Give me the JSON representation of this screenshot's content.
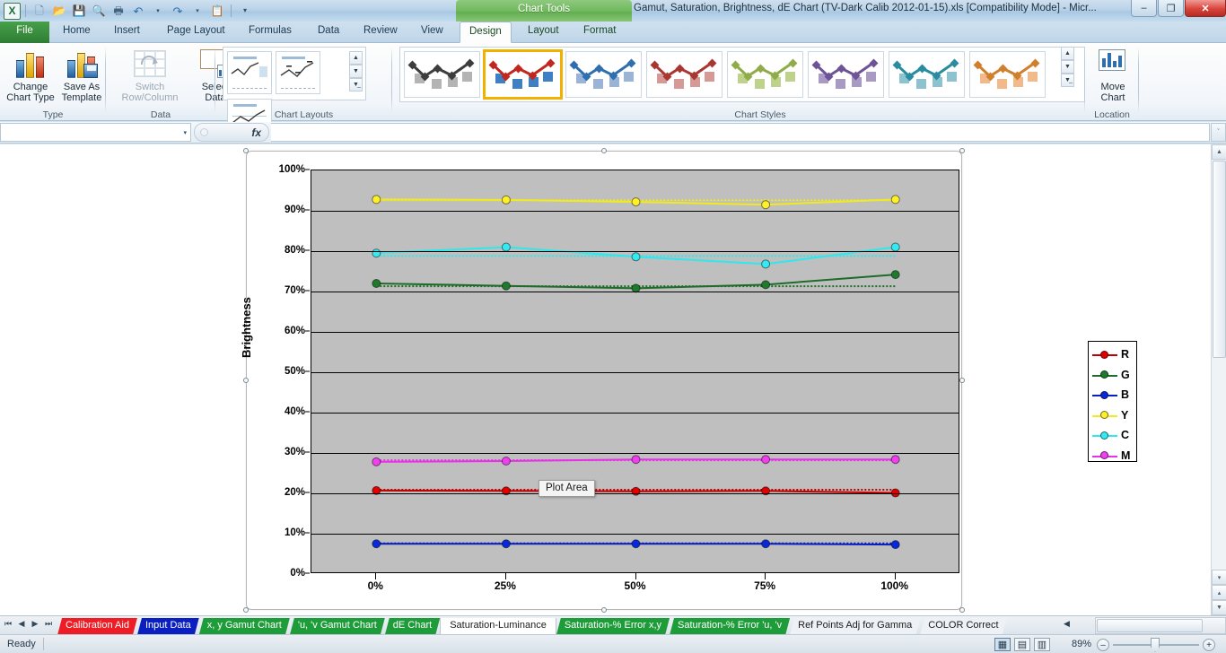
{
  "window": {
    "title": "Gamut, Saturation, Brightness, dE Chart (TV-Dark Calib 2012-01-15).xls  [Compatibility Mode]  -  Micr...",
    "context_tab_group": "Chart Tools",
    "minimize": "–",
    "restore": "❐",
    "close": "✕",
    "ribbon_min": "⌃",
    "help": "?",
    "win_min2": "–",
    "win_restore2": "❐",
    "win_close2": "✕"
  },
  "quick_access": [
    {
      "name": "excel-logo",
      "glyph": "X"
    },
    {
      "name": "new-icon",
      "glyph": "὜B"
    },
    {
      "name": "open-icon",
      "glyph": "Ὄ2"
    },
    {
      "name": "save-icon",
      "glyph": "ὋE"
    },
    {
      "name": "print-preview-icon",
      "glyph": "ὐD"
    },
    {
      "name": "print-icon",
      "glyph": "὚8"
    },
    {
      "name": "undo-icon",
      "glyph": "↶"
    },
    {
      "name": "undo-dropdown-icon",
      "glyph": "▾"
    },
    {
      "name": "redo-icon",
      "glyph": "↷"
    },
    {
      "name": "redo-dropdown-icon",
      "glyph": "▾"
    },
    {
      "name": "paste-icon",
      "glyph": "ὌB"
    },
    {
      "name": "customize-qat-icon",
      "glyph": "▾"
    }
  ],
  "ribbon_tabs": [
    {
      "label": "File",
      "active": false,
      "kind": "file"
    },
    {
      "label": "Home",
      "active": false,
      "kind": "normal"
    },
    {
      "label": "Insert",
      "active": false,
      "kind": "normal"
    },
    {
      "label": "Page Layout",
      "active": false,
      "kind": "normal"
    },
    {
      "label": "Formulas",
      "active": false,
      "kind": "normal"
    },
    {
      "label": "Data",
      "active": false,
      "kind": "normal"
    },
    {
      "label": "Review",
      "active": false,
      "kind": "normal"
    },
    {
      "label": "View",
      "active": false,
      "kind": "normal"
    },
    {
      "label": "Design",
      "active": true,
      "kind": "chart"
    },
    {
      "label": "Layout",
      "active": false,
      "kind": "chart"
    },
    {
      "label": "Format",
      "active": false,
      "kind": "chart"
    }
  ],
  "ribbon": {
    "groups": [
      {
        "label": "Type"
      },
      {
        "label": "Data"
      },
      {
        "label": "Chart Layouts"
      },
      {
        "label": "Chart Styles"
      },
      {
        "label": "Location"
      }
    ],
    "type_group": {
      "change_chart_type": "Change\nChart Type",
      "change_chart_type_l1": "Change",
      "change_chart_type_l2": "Chart Type",
      "save_as_template_l1": "Save As",
      "save_as_template_l2": "Template"
    },
    "data_group": {
      "switch_row_column_l1": "Switch",
      "switch_row_column_l2": "Row/Column",
      "select_data_l1": "Select",
      "select_data_l2": "Data"
    },
    "location_group": {
      "move_chart_l1": "Move",
      "move_chart_l2": "Chart"
    },
    "gallery_scroll": {
      "up": "▲",
      "down": "▼",
      "more": "▼̲"
    },
    "chart_styles": [
      {
        "name": "style-1-grayscale",
        "accent": "#3d3d3d",
        "fill": "#b4b4b4",
        "selected": false
      },
      {
        "name": "style-2-red-blue",
        "accent": "#c0271e",
        "fill": "#3f7fc4",
        "selected": true
      },
      {
        "name": "style-3-blue",
        "accent": "#2f6fae",
        "fill": "#9ab4d8",
        "selected": false
      },
      {
        "name": "style-4-red",
        "accent": "#a83731",
        "fill": "#d59a96",
        "selected": false
      },
      {
        "name": "style-5-green",
        "accent": "#8fac49",
        "fill": "#bed28c",
        "selected": false
      },
      {
        "name": "style-6-purple",
        "accent": "#6e5496",
        "fill": "#a99ac4",
        "selected": false
      },
      {
        "name": "style-7-teal",
        "accent": "#2a8c9e",
        "fill": "#8dc3cf",
        "selected": false
      },
      {
        "name": "style-8-orange",
        "accent": "#d07f2c",
        "fill": "#f2b98a",
        "selected": false
      }
    ]
  },
  "formula_bar": {
    "name_box_value": "",
    "name_box_caret": "▾",
    "fx_label": "fx",
    "formula_value": "",
    "expand_caret": "ˇ"
  },
  "chart_data": {
    "type": "line",
    "title": "",
    "xlabel": "",
    "ylabel": "Brightness",
    "categories": [
      "0%",
      "25%",
      "50%",
      "75%",
      "100%"
    ],
    "x_tick_labels": [
      "0%",
      "25%",
      "50%",
      "75%",
      "100%"
    ],
    "y_tick_labels": [
      "0%",
      "10%",
      "20%",
      "30%",
      "40%",
      "50%",
      "60%",
      "70%",
      "80%",
      "90%",
      "100%"
    ],
    "ylim": [
      0,
      100
    ],
    "y_unit": "%",
    "grid": true,
    "plot_area_fill": "#bfbfbf",
    "legend_position": "right-inside",
    "series": [
      {
        "name": "R",
        "label": "R",
        "color": "#c00000",
        "marker_color": "#e00000",
        "values": [
          20.7,
          20.6,
          20.5,
          20.6,
          20.1
        ],
        "reference_values": [
          20.9,
          20.9,
          20.9,
          20.9,
          20.9
        ]
      },
      {
        "name": "G",
        "label": "G",
        "color": "#1f6b28",
        "marker_color": "#1f7a2e",
        "values": [
          72.0,
          71.4,
          70.8,
          71.7,
          74.2
        ],
        "reference_values": [
          71.3,
          71.3,
          71.3,
          71.3,
          71.3
        ]
      },
      {
        "name": "B",
        "label": "B",
        "color": "#0a1fbf",
        "marker_color": "#0a28d8",
        "values": [
          7.5,
          7.5,
          7.5,
          7.5,
          7.3
        ],
        "reference_values": [
          7.6,
          7.6,
          7.6,
          7.6,
          7.6
        ]
      },
      {
        "name": "Y",
        "label": "Y",
        "color": "#f2ea20",
        "marker_color": "#fff02a",
        "values": [
          92.8,
          92.7,
          92.2,
          91.5,
          92.8
        ],
        "reference_values": [
          92.6,
          92.6,
          92.6,
          92.6,
          92.6
        ]
      },
      {
        "name": "C",
        "label": "C",
        "color": "#2ee8ef",
        "marker_color": "#35e9f2",
        "values": [
          79.5,
          81.0,
          78.6,
          76.8,
          81.0
        ],
        "reference_values": [
          78.8,
          78.8,
          78.8,
          78.8,
          78.8
        ]
      },
      {
        "name": "M",
        "label": "M",
        "color": "#e830e8",
        "marker_color": "#ef3fee",
        "values": [
          27.8,
          28.0,
          28.4,
          28.4,
          28.4
        ],
        "reference_values": [
          28.2,
          28.2,
          28.2,
          28.2,
          28.2
        ]
      }
    ]
  },
  "tooltip": {
    "text": "Plot Area"
  },
  "sheet_tabs": {
    "nav": [
      {
        "name": "first-sheet-button",
        "glyph": "⏮"
      },
      {
        "name": "prev-sheet-button",
        "glyph": "◀"
      },
      {
        "name": "next-sheet-button",
        "glyph": "▶"
      },
      {
        "name": "last-sheet-button",
        "glyph": "⏭"
      }
    ],
    "tabs": [
      {
        "label": "Calibration Aid",
        "bg": "#ee1c25",
        "fg": "#ffffff",
        "active": false
      },
      {
        "label": "Input Data",
        "bg": "#0a1fbf",
        "fg": "#ffffff",
        "active": false
      },
      {
        "label": "x, y Gamut Chart",
        "bg": "#1f9c3a",
        "fg": "#ffffff",
        "active": false
      },
      {
        "label": "'u, 'v Gamut Chart",
        "bg": "#1f9c3a",
        "fg": "#ffffff",
        "active": false
      },
      {
        "label": "dE Chart",
        "bg": "#1f9c3a",
        "fg": "#ffffff",
        "active": false
      },
      {
        "label": "Saturation-Luminance",
        "bg": "#ffffff",
        "fg": "#1b1b1b",
        "active": true
      },
      {
        "label": "Saturation-% Error x,y",
        "bg": "#1f9c3a",
        "fg": "#ffffff",
        "active": false
      },
      {
        "label": "Saturation-% Error 'u, 'v",
        "bg": "#1f9c3a",
        "fg": "#ffffff",
        "active": false
      },
      {
        "label": "Ref Points Adj for Gamma",
        "bg": "#eef2f6",
        "fg": "#1b1b1b",
        "active": false
      },
      {
        "label": "COLOR Correct",
        "bg": "#eef2f6",
        "fg": "#1b1b1b",
        "active": false
      }
    ],
    "scroll_indicator": "◀"
  },
  "status_bar": {
    "state": "Ready",
    "zoom_level": "89%",
    "zoom_out": "–",
    "zoom_in": "+",
    "views": [
      {
        "name": "normal-view-button",
        "glyph": "▦",
        "selected": true
      },
      {
        "name": "page-layout-view-button",
        "glyph": "▤",
        "selected": false
      },
      {
        "name": "page-break-preview-button",
        "glyph": "▥",
        "selected": false
      }
    ]
  }
}
